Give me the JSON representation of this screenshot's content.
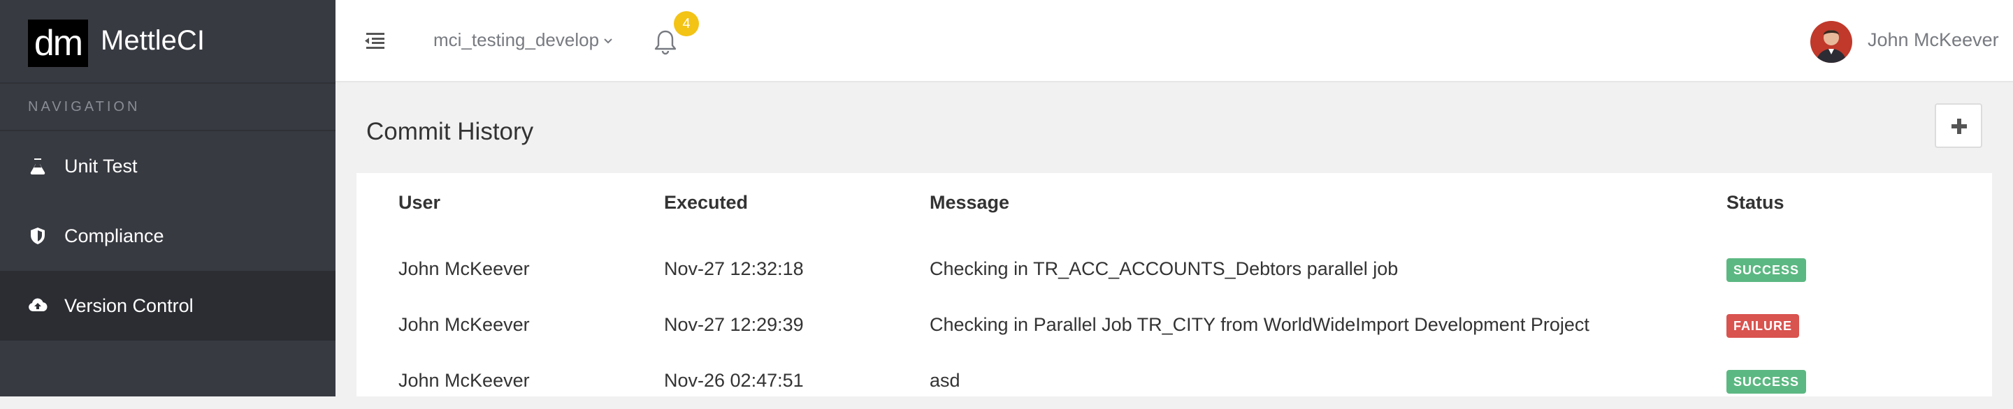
{
  "app": {
    "logo_text": "dm",
    "brand_name": "MettleCI"
  },
  "sidebar": {
    "heading": "NAVIGATION",
    "items": [
      {
        "label": "Unit Test",
        "icon": "flask-icon",
        "active": false
      },
      {
        "label": "Compliance",
        "icon": "shield-icon",
        "active": false
      },
      {
        "label": "Version Control",
        "icon": "cloud-upload-icon",
        "active": true
      }
    ]
  },
  "topbar": {
    "project": "mci_testing_develop",
    "notification_count": "4",
    "user_name": "John McKeever"
  },
  "page": {
    "title": "Commit History"
  },
  "table": {
    "columns": [
      "User",
      "Executed",
      "Message",
      "Status"
    ],
    "rows": [
      {
        "user": "John McKeever",
        "executed": "Nov-27 12:32:18",
        "message": "Checking in TR_ACC_ACCOUNTS_Debtors parallel job",
        "status": "SUCCESS"
      },
      {
        "user": "John McKeever",
        "executed": "Nov-27 12:29:39",
        "message": "Checking in Parallel Job TR_CITY from WorldWideImport Development Project",
        "status": "FAILURE"
      },
      {
        "user": "John McKeever",
        "executed": "Nov-26 02:47:51",
        "message": "asd",
        "status": "SUCCESS"
      }
    ]
  },
  "colors": {
    "sidebar_bg": "#383a42",
    "sidebar_active_bg": "#2b2d33",
    "success": "#5cb882",
    "failure": "#d9534f",
    "badge_notification": "#f3c316"
  }
}
